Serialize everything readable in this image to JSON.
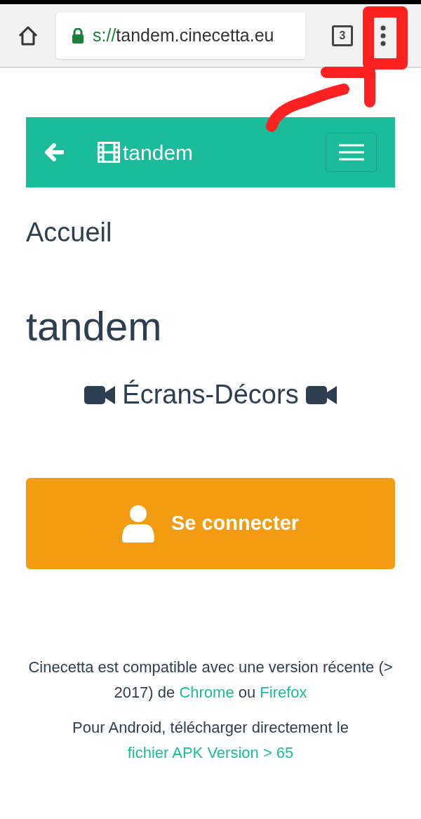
{
  "browser": {
    "url_scheme": "s://",
    "url_host": "tandem.cinecetta.eu",
    "tab_count": "3"
  },
  "navbar": {
    "brand": "tandem"
  },
  "breadcrumb": "Accueil",
  "title": "tandem",
  "subtitle": "Écrans-Décors",
  "login_button": "Se connecter",
  "footer": [
    {
      "parts": [
        {
          "kind": "text",
          "text": "Cinecetta est compatible avec une version récente (> 2017) de "
        },
        {
          "kind": "link",
          "text": "Chrome"
        },
        {
          "kind": "text",
          "text": " ou "
        },
        {
          "kind": "link",
          "text": "Firefox"
        }
      ]
    },
    {
      "parts": [
        {
          "kind": "text",
          "text": "Pour Android, télécharger directement le "
        },
        {
          "kind": "link",
          "text": "fichier APK Version > 65"
        }
      ]
    }
  ]
}
